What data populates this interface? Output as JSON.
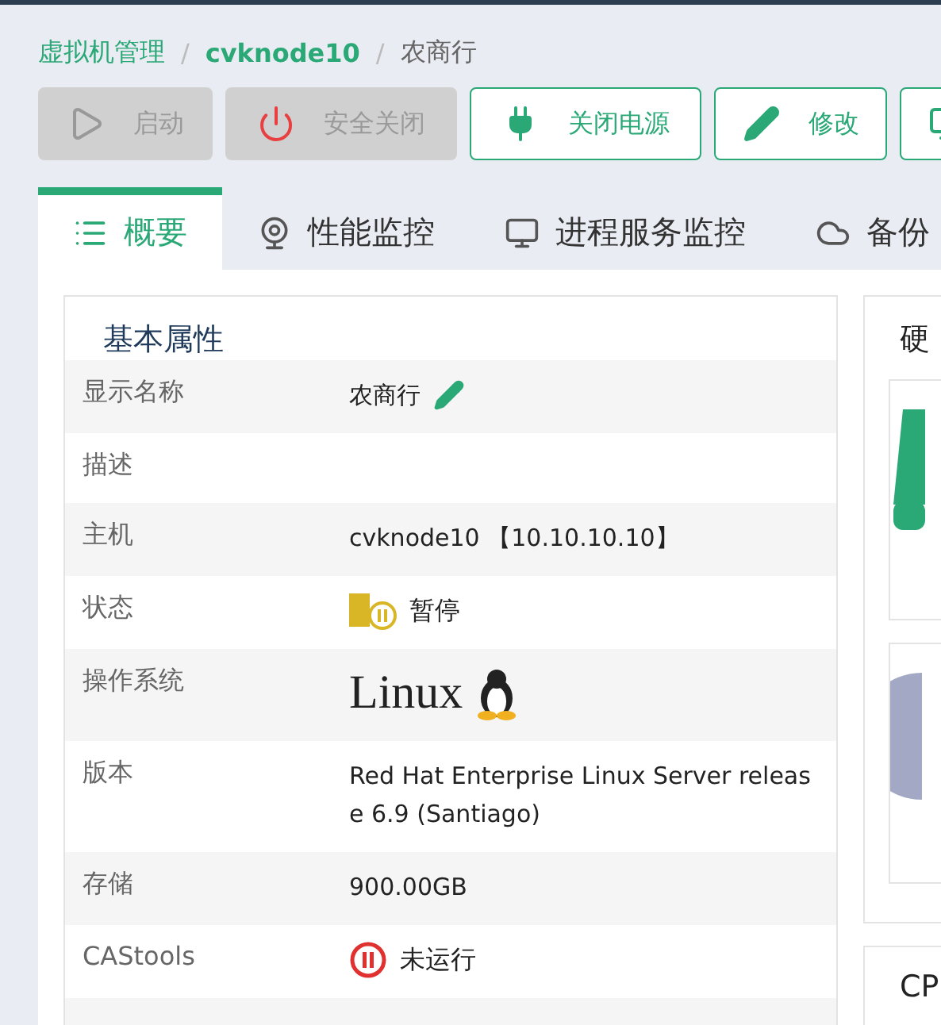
{
  "breadcrumb": [
    {
      "label": "虚拟机管理",
      "current": false
    },
    {
      "label": "cvknode10",
      "current": false
    },
    {
      "label": "农商行",
      "current": true
    }
  ],
  "breadcrumb_separator": "/",
  "actions": [
    {
      "label": "启动",
      "disabled": true
    },
    {
      "label": "安全关闭",
      "disabled": true
    },
    {
      "label": "关闭电源",
      "disabled": false
    },
    {
      "label": "修改",
      "disabled": false
    },
    {
      "disabled": false
    }
  ],
  "tabs": [
    {
      "label": "概要",
      "selected": true
    },
    {
      "label": "性能监控",
      "selected": false
    },
    {
      "label": "进程服务监控",
      "selected": false
    },
    {
      "label": "备份",
      "selected": false
    }
  ],
  "properties": {
    "title": "基本属性",
    "rows": [
      {
        "label": "显示名称",
        "kind": "editable",
        "value": "农商行"
      },
      {
        "label": "描述",
        "kind": "text"
      },
      {
        "label": "主机",
        "kind": "host",
        "value": "cvknode10",
        "extra": "【10.10.10.10】"
      },
      {
        "label": "状态",
        "kind": "paused",
        "value": "暂停"
      },
      {
        "label": "操作系统",
        "kind": "logo",
        "value": "Linux"
      },
      {
        "label": "版本",
        "kind": "text",
        "value": "Red Hat Enterprise Linux Server release 6.9 (Santiago)"
      },
      {
        "label": "存储",
        "kind": "text",
        "value": "900.00GB"
      },
      {
        "label": "CAStools",
        "kind": "stopped",
        "value": "未运行"
      }
    ]
  },
  "hardware": {
    "title": "硬"
  },
  "cpu": {
    "title": "CP"
  }
}
